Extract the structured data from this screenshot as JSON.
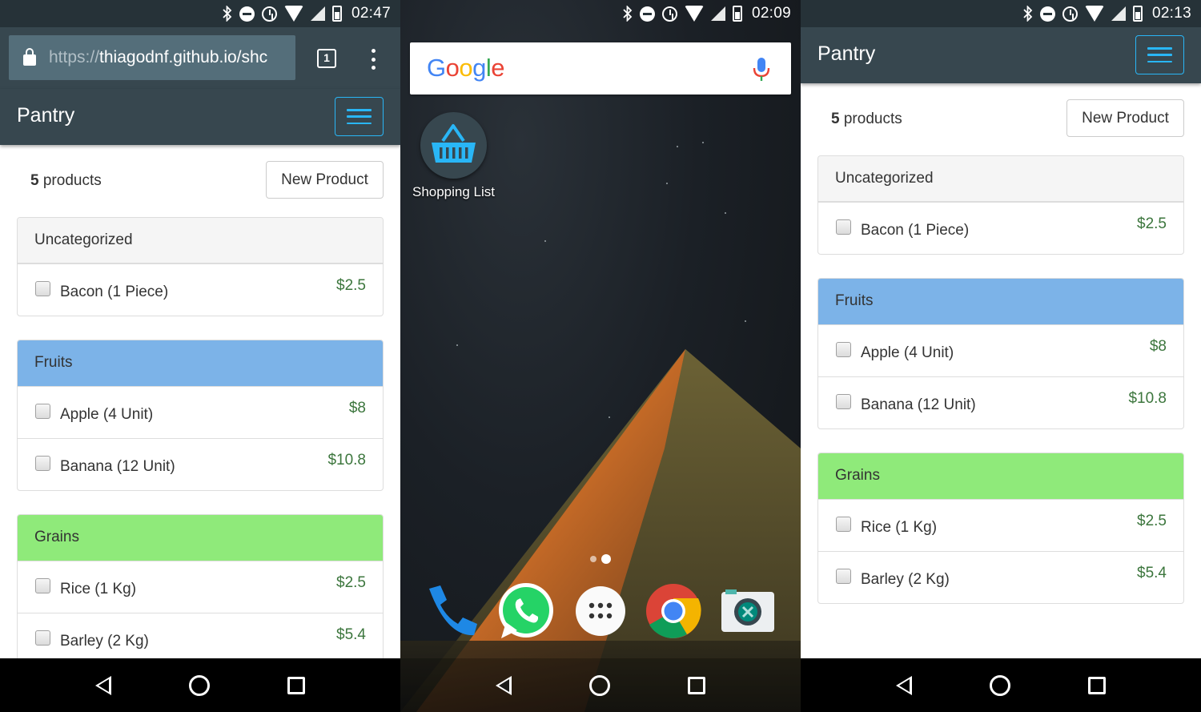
{
  "screen1": {
    "status": {
      "time": "02:47"
    },
    "browser": {
      "url_scheme": "https://",
      "url_rest": "thiagodnf.github.io/shc",
      "tab_count": "1"
    },
    "app": {
      "brand": "Pantry",
      "product_count": "5",
      "product_count_suffix": " products",
      "new_product_label": "New Product",
      "groups": [
        {
          "title": "Uncategorized",
          "items": [
            {
              "name": "Bacon (1 Piece)",
              "price": "$2.5"
            }
          ]
        },
        {
          "title": "Fruits",
          "items": [
            {
              "name": "Apple (4 Unit)",
              "price": "$8"
            },
            {
              "name": "Banana (12 Unit)",
              "price": "$10.8"
            }
          ]
        },
        {
          "title": "Grains",
          "items": [
            {
              "name": "Rice (1 Kg)",
              "price": "$2.5"
            },
            {
              "name": "Barley (2 Kg)",
              "price": "$5.4"
            }
          ]
        }
      ]
    }
  },
  "screen2": {
    "status": {
      "time": "02:09"
    },
    "search": {
      "logo": "Google"
    },
    "shortcut": {
      "label": "Shopping List",
      "icon": "basket-icon"
    },
    "dock": [
      "phone-icon",
      "whatsapp-icon",
      "app-drawer-icon",
      "chrome-icon",
      "camera-icon"
    ]
  },
  "screen3": {
    "status": {
      "time": "02:13"
    },
    "app": {
      "brand": "Pantry",
      "product_count": "5",
      "product_count_suffix": " products",
      "new_product_label": "New Product",
      "groups": [
        {
          "title": "Uncategorized",
          "items": [
            {
              "name": "Bacon (1 Piece)",
              "price": "$2.5"
            }
          ]
        },
        {
          "title": "Fruits",
          "items": [
            {
              "name": "Apple (4 Unit)",
              "price": "$8"
            },
            {
              "name": "Banana (12 Unit)",
              "price": "$10.8"
            }
          ]
        },
        {
          "title": "Grains",
          "items": [
            {
              "name": "Rice (1 Kg)",
              "price": "$2.5"
            },
            {
              "name": "Barley (2 Kg)",
              "price": "$5.4"
            }
          ]
        }
      ]
    }
  },
  "colors": {
    "navbar": "#37474f",
    "accent": "#29b6f6",
    "fruits_heading": "#7cb3e8",
    "grains_heading": "#8fea7a",
    "price": "#3c763d"
  }
}
